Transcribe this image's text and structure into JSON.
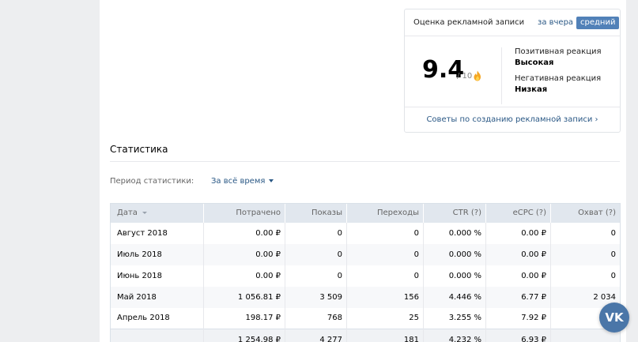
{
  "rating": {
    "title": "Оценка рекламной записи",
    "yesterday": "за вчера",
    "average": "средний",
    "score": "9.4",
    "out_of": "/ 10",
    "positive_label": "Позитивная реакция",
    "positive_value": "Высокая",
    "negative_label": "Негативная реакция",
    "negative_value": "Низкая",
    "tips_link": "Советы по созданию рекламной записи ›"
  },
  "stats": {
    "title": "Статистика",
    "period_label": "Период статистики:",
    "period_value": "За всё время",
    "columns": [
      "Дата",
      "Потрачено",
      "Показы",
      "Переходы",
      "CTR (?)",
      "eCPC (?)",
      "Охват (?)"
    ],
    "rows": [
      [
        "Август 2018",
        "0.00 ₽",
        "0",
        "0",
        "0.000 %",
        "0.00 ₽",
        "0"
      ],
      [
        "Июль 2018",
        "0.00 ₽",
        "0",
        "0",
        "0.000 %",
        "0.00 ₽",
        "0"
      ],
      [
        "Июнь 2018",
        "0.00 ₽",
        "0",
        "0",
        "0.000 %",
        "0.00 ₽",
        "0"
      ],
      [
        "Май 2018",
        "1 056.81 ₽",
        "3 509",
        "156",
        "4.446 %",
        "6.77 ₽",
        "2 034"
      ],
      [
        "Апрель 2018",
        "198.17 ₽",
        "768",
        "25",
        "3.255 %",
        "7.92 ₽",
        ""
      ]
    ],
    "total": [
      "",
      "1 254.98 ₽",
      "4 277",
      "181",
      "4.232 %",
      "6.93 ₽",
      ""
    ]
  },
  "fab": {
    "label": "VK"
  },
  "colors": {
    "accent": "#5181b8",
    "link": "#2a5885",
    "page_bg": "#edeef0",
    "header_bg": "#e1e7ee"
  }
}
